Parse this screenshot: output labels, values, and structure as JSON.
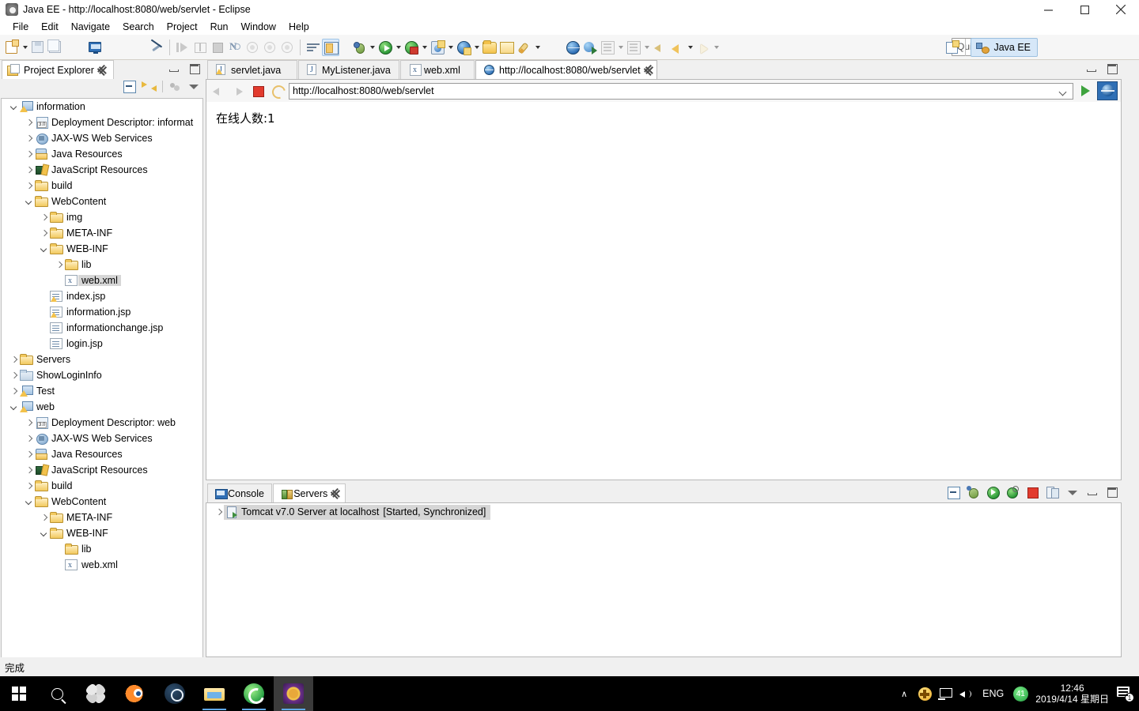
{
  "window": {
    "title": "Java EE - http://localhost:8080/web/servlet - Eclipse",
    "icon": "eclipse-icon",
    "minimize": "–",
    "maximize": "❐",
    "close": "✕"
  },
  "menu": {
    "items": [
      "File",
      "Edit",
      "Navigate",
      "Search",
      "Project",
      "Run",
      "Window",
      "Help"
    ]
  },
  "toolbar": {
    "quick_access_placeholder": "Quick Access",
    "perspective_label": "Java EE",
    "items": [
      {
        "name": "new-icon"
      },
      {
        "name": "save-icon"
      },
      {
        "name": "save-all-icon"
      },
      {
        "name": "monitor-icon"
      },
      {
        "name": "link-with-editor-icon"
      },
      {
        "name": "step-over-icon"
      },
      {
        "name": "columns-icon"
      },
      {
        "name": "terminate-icon"
      },
      {
        "name": "next-annotation-icon"
      },
      {
        "name": "previous-annotation-icon"
      },
      {
        "name": "last-edit-icon"
      },
      {
        "name": "skip-breakpoints-icon"
      },
      {
        "name": "toggle-markers-icon"
      },
      {
        "name": "perspective-icon"
      },
      {
        "name": "debug-icon"
      },
      {
        "name": "run-icon"
      },
      {
        "name": "run-server-icon"
      },
      {
        "name": "new-server-icon"
      },
      {
        "name": "new-web-project-icon"
      },
      {
        "name": "open-type-icon"
      },
      {
        "name": "open-resource-icon"
      },
      {
        "name": "deploy-icon"
      },
      {
        "name": "open-web-browser-icon"
      },
      {
        "name": "external-tools-icon"
      },
      {
        "name": "previous-edit-icon"
      },
      {
        "name": "next-edit-icon"
      },
      {
        "name": "back-icon"
      },
      {
        "name": "forward-icon"
      }
    ]
  },
  "project_explorer": {
    "title": "Project Explorer",
    "controls": [
      "collapse-all-icon",
      "link-with-editor-icon",
      "focus-icon",
      "view-menu-icon"
    ],
    "tree": [
      {
        "label": "information",
        "indent": 0,
        "chevron": "open",
        "icon": "project-warn-icon"
      },
      {
        "label": "Deployment Descriptor: informat",
        "indent": 1,
        "chevron": "closed",
        "icon": "deployment-descriptor-icon"
      },
      {
        "label": "JAX-WS Web Services",
        "indent": 1,
        "chevron": "closed",
        "icon": "jaxws-icon"
      },
      {
        "label": "Java Resources",
        "indent": 1,
        "chevron": "closed",
        "icon": "java-resources-icon"
      },
      {
        "label": "JavaScript Resources",
        "indent": 1,
        "chevron": "closed",
        "icon": "javascript-resources-icon"
      },
      {
        "label": "build",
        "indent": 1,
        "chevron": "closed",
        "icon": "folder-icon"
      },
      {
        "label": "WebContent",
        "indent": 1,
        "chevron": "open",
        "icon": "folder-icon"
      },
      {
        "label": "img",
        "indent": 2,
        "chevron": "closed",
        "icon": "folder-icon"
      },
      {
        "label": "META-INF",
        "indent": 2,
        "chevron": "closed",
        "icon": "folder-icon"
      },
      {
        "label": "WEB-INF",
        "indent": 2,
        "chevron": "open",
        "icon": "folder-icon"
      },
      {
        "label": "lib",
        "indent": 3,
        "chevron": "closed",
        "icon": "folder-icon"
      },
      {
        "label": "web.xml",
        "indent": 3,
        "chevron": "none",
        "icon": "xml-icon",
        "selected": true
      },
      {
        "label": "index.jsp",
        "indent": 2,
        "chevron": "none",
        "icon": "jsp-warn-icon"
      },
      {
        "label": "information.jsp",
        "indent": 2,
        "chevron": "none",
        "icon": "jsp-warn-icon"
      },
      {
        "label": "informationchange.jsp",
        "indent": 2,
        "chevron": "none",
        "icon": "jsp-icon"
      },
      {
        "label": "login.jsp",
        "indent": 2,
        "chevron": "none",
        "icon": "jsp-icon"
      },
      {
        "label": "Servers",
        "indent": 0,
        "chevron": "closed",
        "icon": "folder-icon"
      },
      {
        "label": "ShowLoginInfo",
        "indent": 0,
        "chevron": "closed",
        "icon": "folder-plain-icon"
      },
      {
        "label": "Test",
        "indent": 0,
        "chevron": "closed",
        "icon": "project-warn-icon"
      },
      {
        "label": "web",
        "indent": 0,
        "chevron": "open",
        "icon": "project-warn-icon"
      },
      {
        "label": "Deployment Descriptor: web",
        "indent": 1,
        "chevron": "closed",
        "icon": "deployment-descriptor-icon"
      },
      {
        "label": "JAX-WS Web Services",
        "indent": 1,
        "chevron": "closed",
        "icon": "jaxws-icon"
      },
      {
        "label": "Java Resources",
        "indent": 1,
        "chevron": "closed",
        "icon": "java-resources-icon"
      },
      {
        "label": "JavaScript Resources",
        "indent": 1,
        "chevron": "closed",
        "icon": "javascript-resources-icon"
      },
      {
        "label": "build",
        "indent": 1,
        "chevron": "closed",
        "icon": "folder-icon"
      },
      {
        "label": "WebContent",
        "indent": 1,
        "chevron": "open",
        "icon": "folder-icon"
      },
      {
        "label": "META-INF",
        "indent": 2,
        "chevron": "closed",
        "icon": "folder-icon"
      },
      {
        "label": "WEB-INF",
        "indent": 2,
        "chevron": "open",
        "icon": "folder-icon"
      },
      {
        "label": "lib",
        "indent": 3,
        "chevron": "none",
        "icon": "folder-icon"
      },
      {
        "label": "web.xml",
        "indent": 3,
        "chevron": "none",
        "icon": "xml-icon"
      }
    ]
  },
  "editor": {
    "tabs": [
      {
        "label": "servlet.java",
        "icon": "java-warn-icon",
        "active": false,
        "closable": false
      },
      {
        "label": "MyListener.java",
        "icon": "java-icon",
        "active": false,
        "closable": false
      },
      {
        "label": "web.xml",
        "icon": "xml-icon",
        "active": false,
        "closable": false
      },
      {
        "label": "http://localhost:8080/web/servlet",
        "icon": "web-browser-icon",
        "active": true,
        "closable": true
      }
    ],
    "browser": {
      "url": "http://localhost:8080/web/servlet",
      "back_icon": "back-icon",
      "forward_icon": "forward-icon",
      "stop_icon": "stop-icon",
      "refresh_icon": "refresh-icon",
      "go_icon": "go-icon",
      "open_external_icon": "open-external-browser-icon"
    },
    "page_text": "在线人数:1"
  },
  "fast_view": {
    "icons": [
      "outline-icon",
      "palette-icon",
      "snippets-icon",
      "servers-view-icon",
      "properties-icon",
      "task-list-icon"
    ]
  },
  "bottom_panel": {
    "tabs": [
      {
        "label": "Console",
        "icon": "console-icon",
        "active": false,
        "closable": false
      },
      {
        "label": "Servers",
        "icon": "servers-icon",
        "active": true,
        "closable": true
      }
    ],
    "controls": [
      "collapse-all-icon",
      "debug-server-icon",
      "start-server-icon",
      "profile-server-icon",
      "stop-server-icon",
      "publish-icon",
      "view-menu-icon",
      "minimize-icon",
      "maximize-icon"
    ],
    "rows": [
      {
        "name": "Tomcat v7.0 Server at localhost",
        "status": "[Started, Synchronized]",
        "icon": "tomcat-server-icon",
        "chevron": "closed",
        "selected": true
      }
    ]
  },
  "status_bar": {
    "text": "完成"
  },
  "taskbar": {
    "start_icon": "windows-start-icon",
    "search_icon": "search-icon",
    "apps": [
      {
        "name": "fan-app-icon",
        "running": false,
        "active": false
      },
      {
        "name": "blender-icon",
        "running": false,
        "active": false
      },
      {
        "name": "steam-icon",
        "running": false,
        "active": false
      },
      {
        "name": "file-explorer-icon",
        "running": true,
        "active": false
      },
      {
        "name": "edge-browser-icon",
        "running": true,
        "active": false
      },
      {
        "name": "eclipse-icon",
        "running": true,
        "active": true
      }
    ],
    "tray": {
      "chevron": "∧",
      "icons": [
        "update-shield-icon",
        "network-icon",
        "volume-icon"
      ],
      "language": "ENG",
      "badge_value": "41",
      "time": "12:46",
      "date": "2019/4/14 星期日",
      "notification_count": "1"
    }
  }
}
